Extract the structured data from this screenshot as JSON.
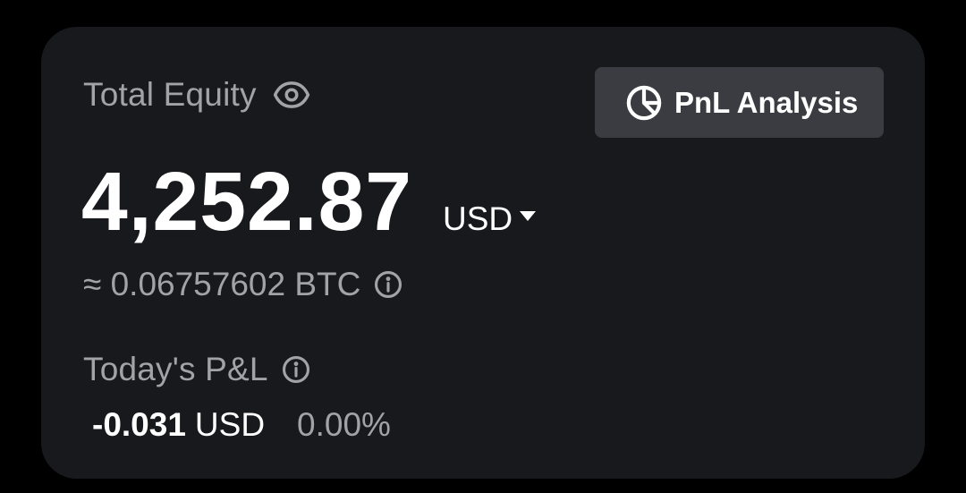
{
  "equity_card": {
    "title": "Total Equity",
    "visibility_icon": "eye-icon",
    "value": "4,252.87",
    "currency": "USD",
    "btc_equivalent": "≈ 0.06757602 BTC",
    "btc_info_icon": "info-icon"
  },
  "pnl_button": {
    "icon": "pie-chart-icon",
    "label": "PnL Analysis"
  },
  "today_pl": {
    "label": "Today's P&L",
    "info_icon": "info-icon",
    "amount": "-0.031",
    "currency": "USD",
    "percent": "0.00%"
  },
  "colors": {
    "background": "#000000",
    "card": "#18191d",
    "button": "#3a3c41",
    "primary_text": "#ffffff",
    "secondary_text": "#a1a3a8"
  }
}
